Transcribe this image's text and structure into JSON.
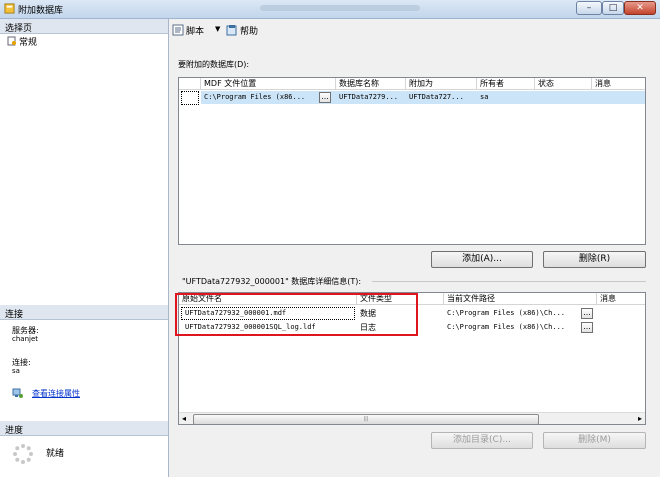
{
  "window": {
    "title": "附加数据库",
    "minimize": "–",
    "maximize": "□",
    "close": "✕"
  },
  "left": {
    "select_page_header": "选择页",
    "pages": [
      {
        "label": "常规"
      }
    ],
    "connection_header": "连接",
    "server_label": "服务器:",
    "server_value": "chanjet",
    "connection_label": "连接:",
    "connection_value": "sa",
    "view_props_link": "查看连接属性",
    "progress_header": "进度",
    "progress_status": "就绪"
  },
  "toolbar": {
    "script_label": "脚本",
    "dropdown_arrow": "▼",
    "help_label": "帮助"
  },
  "attach_section": {
    "label": "要附加的数据库(D):",
    "columns": [
      "MDF 文件位置",
      "数据库名称",
      "附加为",
      "所有者",
      "状态",
      "消息"
    ],
    "rows": [
      {
        "mdf": "C:\\Program Files (x86...",
        "dbname": "UFTData7279...",
        "attach_as": "UFTData727...",
        "owner": "sa",
        "status": "",
        "message": ""
      }
    ],
    "add_button": "添加(A)...",
    "remove_button": "删除(R)"
  },
  "details_section": {
    "label": "\"UFTData727932_000001\" 数据库详细信息(T):",
    "columns": [
      "原始文件名",
      "文件类型",
      "当前文件路径",
      "消息"
    ],
    "rows": [
      {
        "name": "UFTData727932_000001.mdf",
        "type": "数据",
        "path": "C:\\Program Files (x86)\\Ch..."
      },
      {
        "name": "UFTData727932_000001SQL_log.ldf",
        "type": "日志",
        "path": "C:\\Program Files (x86)\\Ch..."
      }
    ],
    "scroll_left": "◂",
    "scroll_mid": "|||",
    "scroll_right": "▸",
    "add_catalog_button": "添加目录(C)...",
    "remove_button": "删除(M)"
  },
  "colors": {
    "highlight_box": "#e0141e",
    "selection": "#cce4f7"
  }
}
